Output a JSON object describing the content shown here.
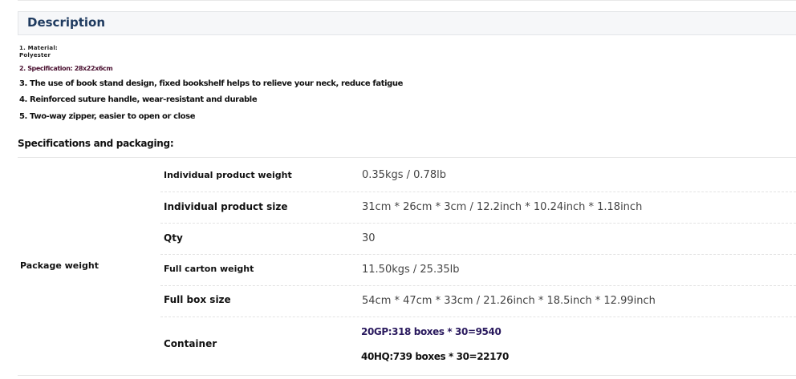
{
  "description": {
    "title": "Description"
  },
  "points": {
    "material_line1": "1. Material:",
    "material_line2": "Polyester",
    "specification": "2. Specification: 28x22x6cm",
    "point3": "3. The use of book stand design, fixed bookshelf helps to relieve your neck, reduce fatigue",
    "point4": "4. Reinforced suture handle, wear-resistant and durable",
    "point5": "5. Two-way zipper, easier to open or close"
  },
  "specs": {
    "heading": "Specifications and packaging:",
    "group_label": "Package weight",
    "rows": [
      {
        "label": "Individual product weight",
        "value": "0.35kgs / 0.78lb"
      },
      {
        "label": "Individual product size",
        "value": "31cm * 26cm * 3cm / 12.2inch * 10.24inch * 1.18inch"
      },
      {
        "label": "Qty",
        "value": "30"
      },
      {
        "label": "Full carton weight",
        "value": "11.50kgs / 25.35lb"
      },
      {
        "label": "Full box size",
        "value": "54cm * 47cm * 33cm / 21.26inch * 18.5inch * 12.99inch"
      }
    ],
    "container": {
      "label": "Container",
      "values": [
        "20GP:318 boxes * 30=9540",
        "40HQ:739 boxes * 30=22170"
      ]
    }
  },
  "colors": {
    "title": "#1e3a5f",
    "spec_accent": "#4a1030",
    "container_20gp": "#2a1a5e",
    "container_40hq": "#111111"
  }
}
